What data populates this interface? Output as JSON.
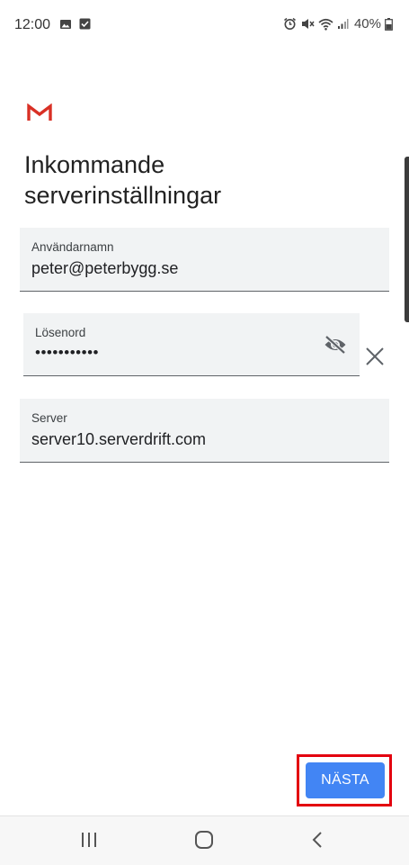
{
  "status_bar": {
    "time": "12:00",
    "battery": "40%",
    "left_icons": [
      "image-icon",
      "check-square-icon"
    ],
    "right_icons": [
      "alarm-icon",
      "mute-icon",
      "wifi-icon",
      "signal-icon",
      "battery-icon"
    ]
  },
  "app": {
    "logo": "gmail-logo",
    "accent": "#4285f4"
  },
  "page": {
    "title_line1": "Inkommande",
    "title_line2": "serverinställningar"
  },
  "form": {
    "username": {
      "label": "Användarnamn",
      "value": "peter@peterbygg.se"
    },
    "password": {
      "label": "Lösenord",
      "value": "•••••••••••",
      "toggle_icon": "visibility-off-icon",
      "clear_icon": "close-icon"
    },
    "server": {
      "label": "Server",
      "value": "server10.serverdrift.com"
    }
  },
  "actions": {
    "next_label": "NÄSTA",
    "highlight_color": "#e3000f"
  },
  "nav_bar": {
    "buttons": [
      "recent-apps-icon",
      "home-icon",
      "back-icon"
    ]
  }
}
